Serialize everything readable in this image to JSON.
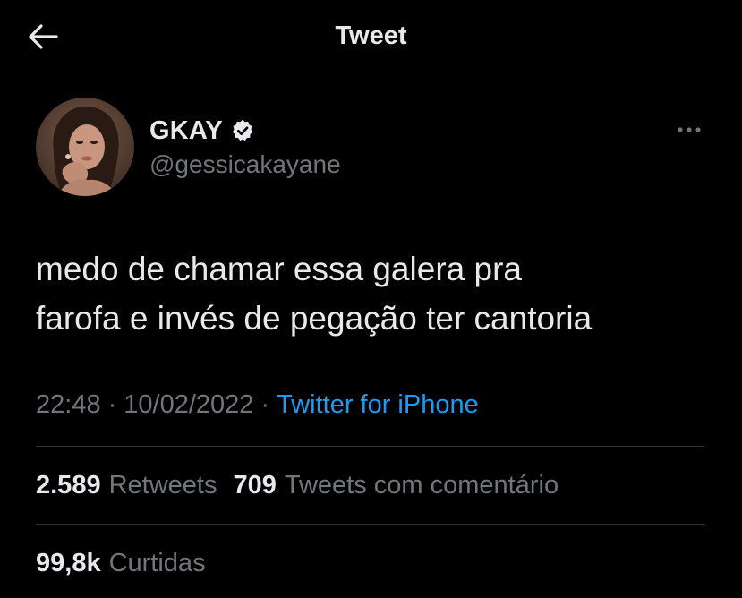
{
  "header": {
    "title": "Tweet",
    "back_icon": "arrow-left-icon"
  },
  "author": {
    "name": "GKAY",
    "handle": "@gessicakayane",
    "verified_icon": "verified-badge-icon",
    "more_icon": "more-options-icon"
  },
  "tweet": {
    "text": "medo de chamar essa galera pra\nfarofa e invés de pegação ter cantoria"
  },
  "meta": {
    "time": "22:48",
    "separator": "·",
    "date": "10/02/2022",
    "source": "Twitter for iPhone"
  },
  "stats": {
    "retweets_count": "2.589",
    "retweets_label": "Retweets",
    "quotes_count": "709",
    "quotes_label": "Tweets com comentário",
    "likes_count": "99,8k",
    "likes_label": "Curtidas"
  },
  "colors": {
    "background": "#000000",
    "primary_text": "#e7e9ea",
    "secondary_text": "#71767b",
    "link": "#1d9bf0",
    "divider": "#2f3336"
  }
}
